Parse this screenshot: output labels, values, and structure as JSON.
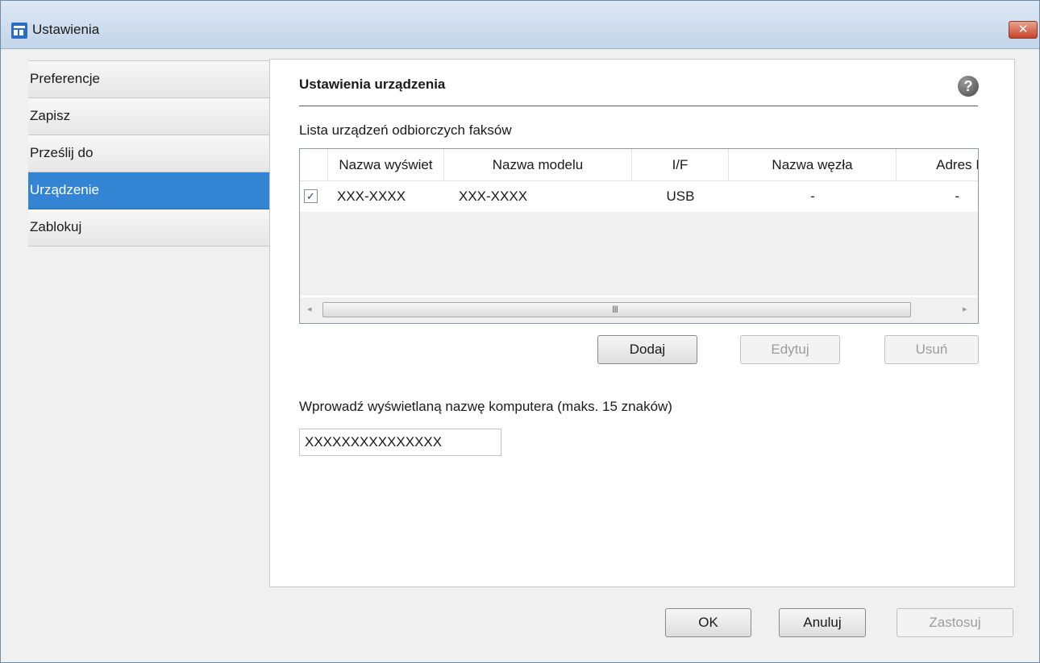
{
  "window": {
    "title": "Ustawienia",
    "close_symbol": "✕"
  },
  "sidebar": {
    "items": [
      {
        "label": "Preferencje",
        "active": false
      },
      {
        "label": "Zapisz",
        "active": false
      },
      {
        "label": "Prześlij do",
        "active": false
      },
      {
        "label": "Urządzenie",
        "active": true
      },
      {
        "label": "Zablokuj",
        "active": false
      }
    ]
  },
  "panel": {
    "title": "Ustawienia urządzenia",
    "help_symbol": "?",
    "list_label": "Lista urządzeń odbiorczych faksów",
    "columns": [
      "Nazwa wyświet",
      "Nazwa modelu",
      "I/F",
      "Nazwa węzła",
      "Adres I"
    ],
    "rows": [
      {
        "checked": true,
        "check_symbol": "✓",
        "display_name": "XXX-XXXX",
        "model_name": "XXX-XXXX",
        "interface": "USB",
        "node_name": "-",
        "address": "-"
      }
    ],
    "scroll_left_symbol": "◂",
    "scroll_right_symbol": "▸",
    "scroll_grip": "III",
    "buttons": {
      "add": "Dodaj",
      "edit": "Edytuj",
      "remove": "Usuń"
    },
    "computer_name_label": "Wprowadź wyświetlaną nazwę komputera (maks. 15 znaków)",
    "computer_name_value": "XXXXXXXXXXXXXXX"
  },
  "footer": {
    "ok": "OK",
    "cancel": "Anuluj",
    "apply": "Zastosuj"
  }
}
